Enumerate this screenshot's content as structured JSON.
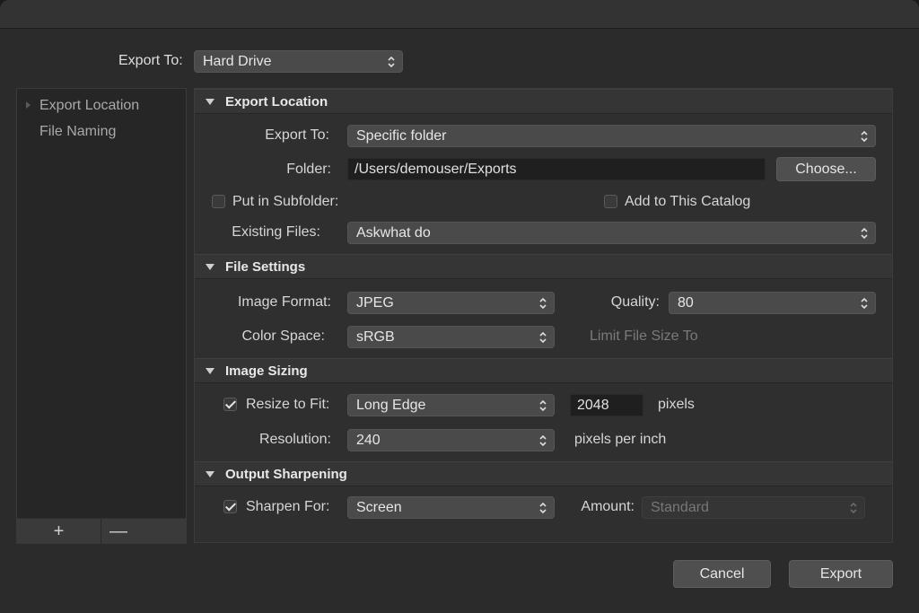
{
  "top": {
    "export_to_label": "Export To:",
    "export_to_value": "Hard Drive"
  },
  "sidebar": {
    "items": [
      {
        "label": "Export Location"
      },
      {
        "label": "File Naming"
      }
    ],
    "add_label": "+",
    "remove_label": "—"
  },
  "sections": {
    "export_location": {
      "title": "Export Location",
      "export_to_label": "Export To:",
      "export_to_value": "Specific folder",
      "folder_label": "Folder:",
      "folder_value": "/Users/demouser/Exports",
      "choose_label": "Choose...",
      "subfolder_label": "Put in Subfolder:",
      "subfolder_checked": false,
      "add_catalog_label": "Add to This Catalog",
      "add_catalog_checked": false,
      "existing_files_label": "Existing Files:",
      "existing_files_value": "Askwhat do"
    },
    "file_settings": {
      "title": "File Settings",
      "image_format_label": "Image Format:",
      "image_format_value": "JPEG",
      "quality_label": "Quality:",
      "quality_value": "80",
      "color_space_label": "Color Space:",
      "color_space_value": "sRGB",
      "limit_size_label": "Limit File Size To"
    },
    "image_sizing": {
      "title": "Image Sizing",
      "resize_label": "Resize to Fit:",
      "resize_checked": true,
      "resize_value": "Long Edge",
      "size_value": "2048",
      "size_unit": "pixels",
      "resolution_label": "Resolution:",
      "resolution_value": "240",
      "resolution_unit": "pixels per inch"
    },
    "output_sharpening": {
      "title": "Output Sharpening",
      "sharpen_label": "Sharpen For:",
      "sharpen_checked": true,
      "sharpen_value": "Screen",
      "amount_label": "Amount:",
      "amount_value": "Standard"
    }
  },
  "footer": {
    "cancel_label": "Cancel",
    "export_label": "Export"
  },
  "icons": {
    "popup": "chevron-up-down-icon",
    "disclosure": "disclosure-triangle-icon",
    "check": "checkmark-icon"
  }
}
